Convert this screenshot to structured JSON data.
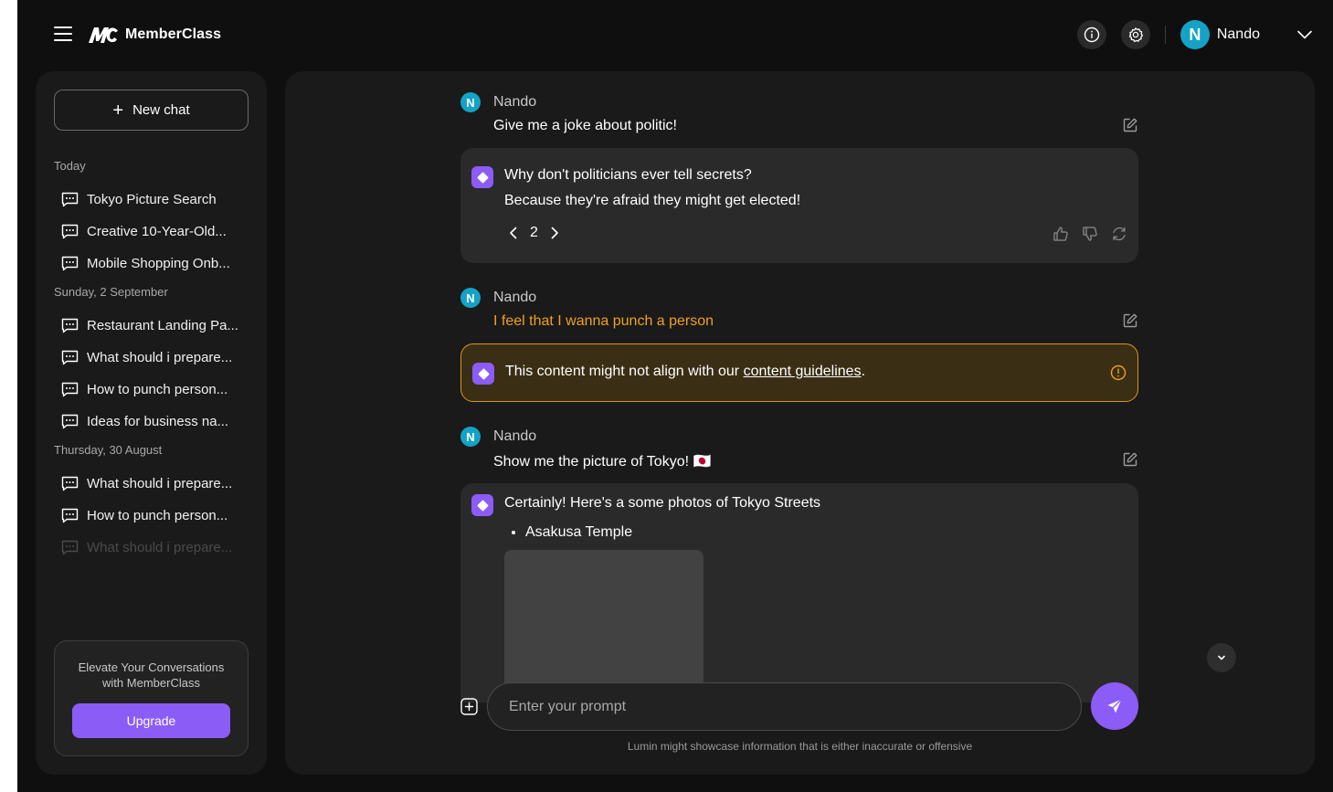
{
  "app": {
    "brand": "MemberClass"
  },
  "header": {
    "user_initial": "N",
    "user_name": "Nando"
  },
  "sidebar": {
    "new_chat_label": "New chat",
    "sections": [
      {
        "title": "Today",
        "items": [
          "Tokyo Picture Search",
          "Creative 10-Year-Old...",
          "Mobile Shopping Onb..."
        ]
      },
      {
        "title": "Sunday, 2 September",
        "items": [
          "Restaurant Landing Pa...",
          "What should i prepare...",
          "How to punch person...",
          "Ideas for business na..."
        ]
      },
      {
        "title": "Thursday, 30 August",
        "items": [
          "What should i prepare...",
          "How to punch person...",
          "What should i prepare..."
        ]
      }
    ],
    "upgrade": {
      "text": "Elevate Your Conversations with MemberClass",
      "button": "Upgrade"
    }
  },
  "chat": {
    "messages": [
      {
        "user_initial": "N",
        "user_name": "Nando",
        "text": "Give me a joke about politic!"
      },
      {
        "user_initial": "N",
        "user_name": "Nando",
        "text": "I feel that I wanna punch a person"
      },
      {
        "user_initial": "N",
        "user_name": "Nando",
        "text": "Show me the picture of Tokyo! 🇯🇵"
      }
    ],
    "reply1": {
      "line1": "Why don't politicians ever tell secrets?",
      "line2": "Because they're afraid they might get elected!",
      "page": "2"
    },
    "warning": {
      "prefix": "This content might not align with our ",
      "link": "content guidelines",
      "suffix": "."
    },
    "reply3": {
      "line1": "Certainly! Here's a some photos of Tokyo Streets",
      "bullet": "Asakusa Temple"
    }
  },
  "composer": {
    "placeholder": "Enter your prompt",
    "disclaimer": "Lumin might showcase information that is either inaccurate or offensive"
  },
  "colors": {
    "accent": "#8b5cf6",
    "avatar": "#14a3c7",
    "warning": "#f0a020",
    "panel": "#1a1a1a",
    "background": "#0f0f0f"
  }
}
